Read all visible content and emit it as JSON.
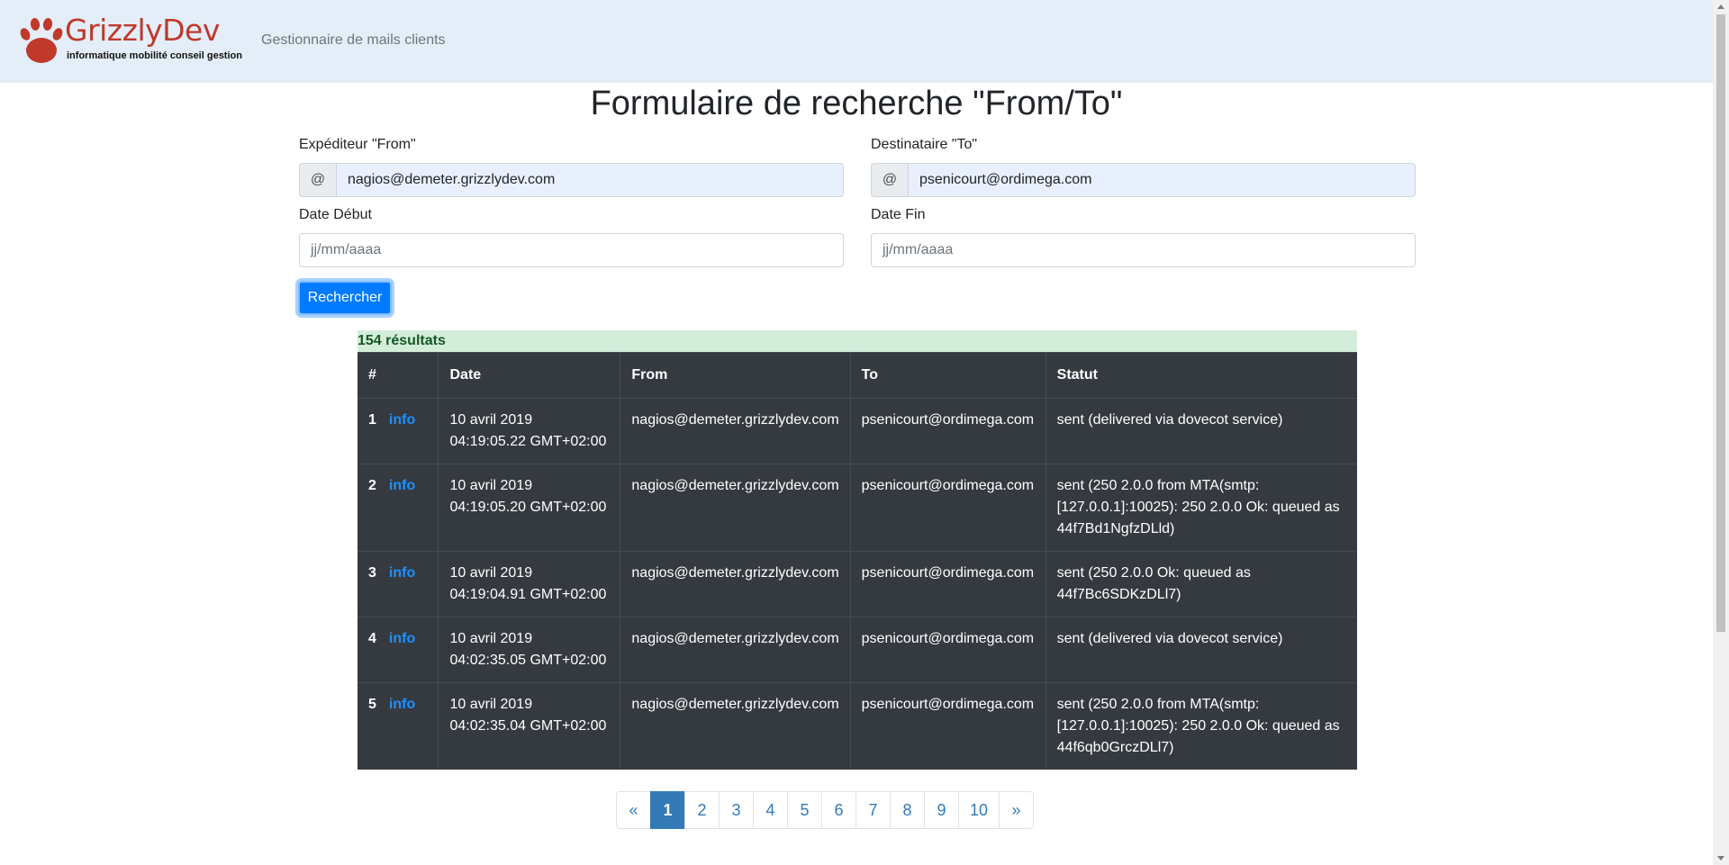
{
  "header": {
    "logo_title": "GrizzlyDev",
    "logo_tagline": "informatique mobilité conseil gestion",
    "app_subtitle": "Gestionnaire de mails clients"
  },
  "page": {
    "title": "Formulaire de recherche \"From/To\""
  },
  "form": {
    "from_label": "Expéditeur \"From\"",
    "from_addon": "@",
    "from_value": "nagios@demeter.grizzlydev.com",
    "to_label": "Destinataire \"To\"",
    "to_addon": "@",
    "to_value": "psenicourt@ordimega.com",
    "date_start_label": "Date Début",
    "date_start_placeholder": "jj/mm/aaaa",
    "date_end_label": "Date Fin",
    "date_end_placeholder": "jj/mm/aaaa",
    "search_button": "Rechercher"
  },
  "results": {
    "count_text": "154 résultats",
    "columns": [
      "#",
      "Date",
      "From",
      "To",
      "Statut"
    ],
    "info_label": "info",
    "rows": [
      {
        "num": "1",
        "date": "10 avril 2019 04:19:05.22 GMT+02:00",
        "from": "nagios@demeter.grizzlydev.com",
        "to": "psenicourt@ordimega.com",
        "status": "sent (delivered via dovecot service)"
      },
      {
        "num": "2",
        "date": "10 avril 2019 04:19:05.20 GMT+02:00",
        "from": "nagios@demeter.grizzlydev.com",
        "to": "psenicourt@ordimega.com",
        "status": "sent (250 2.0.0 from MTA(smtp:[127.0.0.1]:10025): 250 2.0.0 Ok: queued as 44f7Bd1NgfzDLld)"
      },
      {
        "num": "3",
        "date": "10 avril 2019 04:19:04.91 GMT+02:00",
        "from": "nagios@demeter.grizzlydev.com",
        "to": "psenicourt@ordimega.com",
        "status": "sent (250 2.0.0 Ok: queued as 44f7Bc6SDKzDLl7)"
      },
      {
        "num": "4",
        "date": "10 avril 2019 04:02:35.05 GMT+02:00",
        "from": "nagios@demeter.grizzlydev.com",
        "to": "psenicourt@ordimega.com",
        "status": "sent (delivered via dovecot service)"
      },
      {
        "num": "5",
        "date": "10 avril 2019 04:02:35.04 GMT+02:00",
        "from": "nagios@demeter.grizzlydev.com",
        "to": "psenicourt@ordimega.com",
        "status": "sent (250 2.0.0 from MTA(smtp:[127.0.0.1]:10025): 250 2.0.0 Ok: queued as 44f6qb0GrczDLl7)"
      }
    ]
  },
  "pagination": {
    "prev": "«",
    "pages": [
      "1",
      "2",
      "3",
      "4",
      "5",
      "6",
      "7",
      "8",
      "9",
      "10"
    ],
    "active_page": "1",
    "next": "»"
  },
  "colors": {
    "primary": "#007bff",
    "header_bg": "#e3eef9",
    "table_bg": "#343a40",
    "success_bg": "#d4edda"
  }
}
